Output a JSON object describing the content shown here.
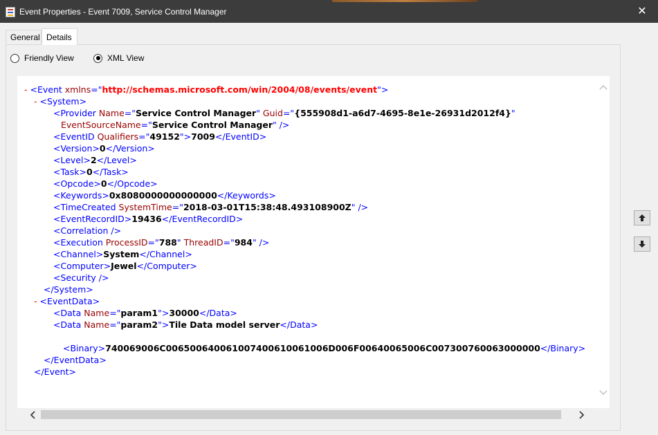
{
  "window": {
    "title": "Event Properties - Event 7009, Service Control Manager",
    "close_label": "✕",
    "icon": "event-viewer-icon"
  },
  "tabs": [
    {
      "label": "General",
      "selected": false
    },
    {
      "label": "Details",
      "selected": true
    }
  ],
  "view_options": {
    "friendly": {
      "label": "Friendly View",
      "selected": false
    },
    "xml": {
      "label": "XML View",
      "selected": true
    }
  },
  "xml_lines": [
    {
      "indent": 0,
      "tokens": [
        {
          "c": "m",
          "t": "- "
        },
        {
          "c": "t",
          "t": "<Event "
        },
        {
          "c": "a",
          "t": "xmlns"
        },
        {
          "c": "t",
          "t": "=\""
        },
        {
          "c": "u",
          "t": "http://schemas.microsoft.com/win/2004/08/events/event"
        },
        {
          "c": "t",
          "t": "\">"
        }
      ]
    },
    {
      "indent": 1,
      "tokens": [
        {
          "c": "m",
          "t": "- "
        },
        {
          "c": "t",
          "t": "<System>"
        }
      ]
    },
    {
      "indent": 3,
      "tokens": [
        {
          "c": "t",
          "t": "<Provider "
        },
        {
          "c": "a",
          "t": "Name"
        },
        {
          "c": "t",
          "t": "=\""
        },
        {
          "c": "v",
          "t": "Service Control Manager"
        },
        {
          "c": "t",
          "t": "\" "
        },
        {
          "c": "a",
          "t": "Guid"
        },
        {
          "c": "t",
          "t": "=\""
        },
        {
          "c": "v",
          "t": "{555908d1-a6d7-4695-8e1e-26931d2012f4}"
        },
        {
          "c": "t",
          "t": "\""
        }
      ]
    },
    {
      "indent": 4,
      "tokens": [
        {
          "c": "a",
          "t": "EventSourceName"
        },
        {
          "c": "t",
          "t": "=\""
        },
        {
          "c": "v",
          "t": "Service Control Manager"
        },
        {
          "c": "t",
          "t": "\" />"
        }
      ]
    },
    {
      "indent": 3,
      "tokens": [
        {
          "c": "t",
          "t": "<EventID "
        },
        {
          "c": "a",
          "t": "Qualifiers"
        },
        {
          "c": "t",
          "t": "=\""
        },
        {
          "c": "v",
          "t": "49152"
        },
        {
          "c": "t",
          "t": "\">"
        },
        {
          "c": "v",
          "t": "7009"
        },
        {
          "c": "t",
          "t": "</EventID>"
        }
      ]
    },
    {
      "indent": 3,
      "tokens": [
        {
          "c": "t",
          "t": "<Version>"
        },
        {
          "c": "v",
          "t": "0"
        },
        {
          "c": "t",
          "t": "</Version>"
        }
      ]
    },
    {
      "indent": 3,
      "tokens": [
        {
          "c": "t",
          "t": "<Level>"
        },
        {
          "c": "v",
          "t": "2"
        },
        {
          "c": "t",
          "t": "</Level>"
        }
      ]
    },
    {
      "indent": 3,
      "tokens": [
        {
          "c": "t",
          "t": "<Task>"
        },
        {
          "c": "v",
          "t": "0"
        },
        {
          "c": "t",
          "t": "</Task>"
        }
      ]
    },
    {
      "indent": 3,
      "tokens": [
        {
          "c": "t",
          "t": "<Opcode>"
        },
        {
          "c": "v",
          "t": "0"
        },
        {
          "c": "t",
          "t": "</Opcode>"
        }
      ]
    },
    {
      "indent": 3,
      "tokens": [
        {
          "c": "t",
          "t": "<Keywords>"
        },
        {
          "c": "v",
          "t": "0x8080000000000000"
        },
        {
          "c": "t",
          "t": "</Keywords>"
        }
      ]
    },
    {
      "indent": 3,
      "tokens": [
        {
          "c": "t",
          "t": "<TimeCreated "
        },
        {
          "c": "a",
          "t": "SystemTime"
        },
        {
          "c": "t",
          "t": "=\""
        },
        {
          "c": "v",
          "t": "2018-03-01T15:38:48.493108900Z"
        },
        {
          "c": "t",
          "t": "\" />"
        }
      ]
    },
    {
      "indent": 3,
      "tokens": [
        {
          "c": "t",
          "t": "<EventRecordID>"
        },
        {
          "c": "v",
          "t": "19436"
        },
        {
          "c": "t",
          "t": "</EventRecordID>"
        }
      ]
    },
    {
      "indent": 3,
      "tokens": [
        {
          "c": "t",
          "t": "<Correlation />"
        }
      ]
    },
    {
      "indent": 3,
      "tokens": [
        {
          "c": "t",
          "t": "<Execution "
        },
        {
          "c": "a",
          "t": "ProcessID"
        },
        {
          "c": "t",
          "t": "=\""
        },
        {
          "c": "v",
          "t": "788"
        },
        {
          "c": "t",
          "t": "\" "
        },
        {
          "c": "a",
          "t": "ThreadID"
        },
        {
          "c": "t",
          "t": "=\""
        },
        {
          "c": "v",
          "t": "984"
        },
        {
          "c": "t",
          "t": "\" />"
        }
      ]
    },
    {
      "indent": 3,
      "tokens": [
        {
          "c": "t",
          "t": "<Channel>"
        },
        {
          "c": "v",
          "t": "System"
        },
        {
          "c": "t",
          "t": "</Channel>"
        }
      ]
    },
    {
      "indent": 3,
      "tokens": [
        {
          "c": "t",
          "t": "<Computer>"
        },
        {
          "c": "v",
          "t": "Jewel"
        },
        {
          "c": "t",
          "t": "</Computer>"
        }
      ]
    },
    {
      "indent": 3,
      "tokens": [
        {
          "c": "t",
          "t": "<Security />"
        }
      ]
    },
    {
      "indent": 2,
      "tokens": [
        {
          "c": "t",
          "t": "</System>"
        }
      ]
    },
    {
      "indent": 1,
      "tokens": [
        {
          "c": "m",
          "t": "- "
        },
        {
          "c": "t",
          "t": "<EventData>"
        }
      ]
    },
    {
      "indent": 3,
      "tokens": [
        {
          "c": "t",
          "t": "<Data "
        },
        {
          "c": "a",
          "t": "Name"
        },
        {
          "c": "t",
          "t": "=\""
        },
        {
          "c": "v",
          "t": "param1"
        },
        {
          "c": "t",
          "t": "\">"
        },
        {
          "c": "v",
          "t": "30000"
        },
        {
          "c": "t",
          "t": "</Data>"
        }
      ]
    },
    {
      "indent": 3,
      "tokens": [
        {
          "c": "t",
          "t": "<Data "
        },
        {
          "c": "a",
          "t": "Name"
        },
        {
          "c": "t",
          "t": "=\""
        },
        {
          "c": "v",
          "t": "param2"
        },
        {
          "c": "t",
          "t": "\">"
        },
        {
          "c": "v",
          "t": "Tile Data model server"
        },
        {
          "c": "t",
          "t": "</Data>"
        }
      ]
    },
    {
      "indent": 3,
      "tokens": []
    },
    {
      "indent": 5,
      "tokens": [
        {
          "c": "t",
          "t": "<Binary>"
        },
        {
          "c": "v",
          "t": "740069006C006500640061007400610061006D006F00640065006C007300760063000000"
        },
        {
          "c": "t",
          "t": "</Binary>"
        }
      ]
    },
    {
      "indent": 2,
      "tokens": [
        {
          "c": "t",
          "t": "</EventData>"
        }
      ]
    },
    {
      "indent": 1,
      "tokens": [
        {
          "c": "t",
          "t": "</Event>"
        }
      ]
    }
  ],
  "colors": {
    "tag": "#0000ff",
    "attribute": "#990000",
    "url": "#ff0000",
    "collapse_marker": "#ff0000"
  },
  "scroll": {
    "up_icon": "chevron-up-icon",
    "down_icon": "chevron-down-icon",
    "left_icon": "chevron-left-icon",
    "right_icon": "chevron-right-icon"
  },
  "nav": {
    "previous_icon": "arrow-up-icon",
    "next_icon": "arrow-down-icon"
  }
}
